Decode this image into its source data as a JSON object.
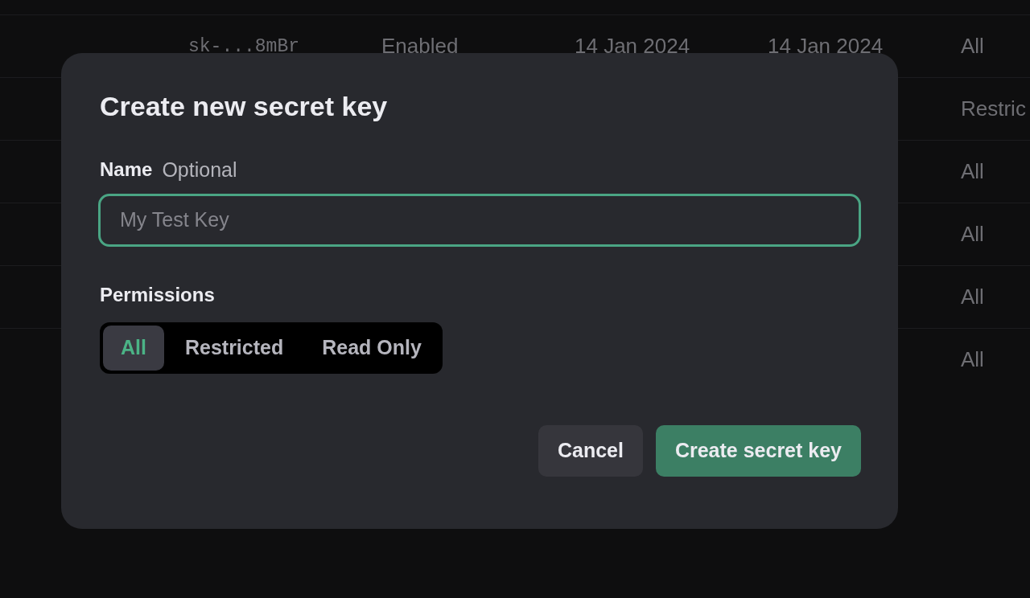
{
  "keys_table": {
    "rows": [
      {
        "cells": [
          "sk-...8mBr",
          "Enabled",
          "14 Jan 2024",
          "14 Jan 2024",
          "All"
        ]
      },
      {
        "cells": [
          "",
          "",
          "",
          "",
          "Restric"
        ]
      },
      {
        "cells": [
          "",
          "",
          "",
          "",
          "All"
        ]
      },
      {
        "cells": [
          "",
          "",
          "",
          "",
          "All"
        ]
      },
      {
        "cells": [
          "",
          "",
          "",
          "",
          "All"
        ]
      },
      {
        "cells": [
          "",
          "",
          "",
          "",
          "All"
        ]
      }
    ]
  },
  "dialog": {
    "title": "Create new secret key",
    "name_label": "Name",
    "name_hint": "Optional",
    "name_field": {
      "placeholder": "My Test Key",
      "focused": true
    },
    "permissions_label": "Permissions",
    "permissions": [
      {
        "label": "All",
        "selected": true
      },
      {
        "label": "Restricted",
        "selected": false
      },
      {
        "label": "Read Only",
        "selected": false
      }
    ],
    "buttons": [
      {
        "label": "Cancel",
        "kind": "secondary"
      },
      {
        "label": "Create secret key",
        "kind": "primary"
      }
    ]
  }
}
